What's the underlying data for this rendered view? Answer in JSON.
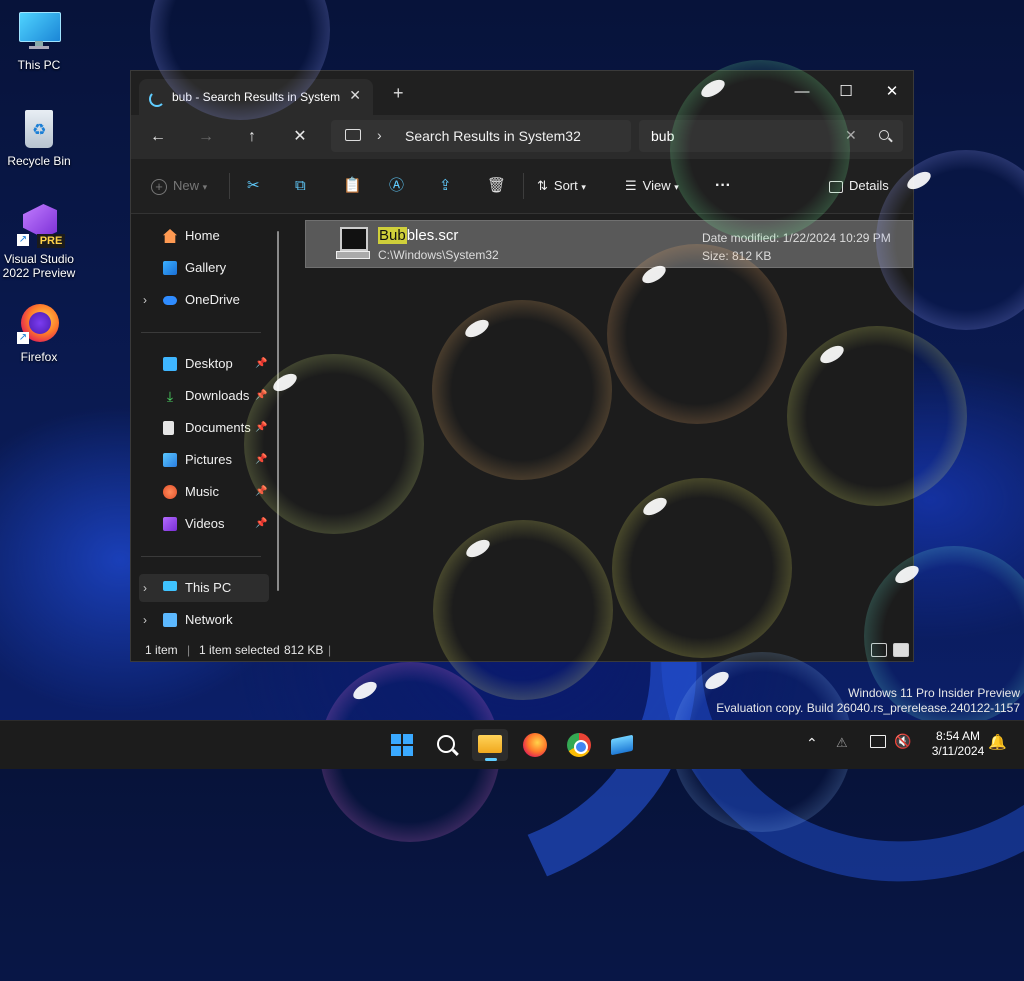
{
  "desktop": {
    "icons": [
      {
        "label": "This PC"
      },
      {
        "label": "Recycle Bin"
      },
      {
        "label_line1": "Visual Studio",
        "label_line2": "2022 Preview",
        "badge": "PRE"
      },
      {
        "label": "Firefox"
      }
    ]
  },
  "window": {
    "tab_title": "bub - Search Results in System",
    "tab_close": "✕",
    "new_tab": "+",
    "controls": {
      "minimize": "—",
      "maximize": "☐",
      "close": "✕"
    },
    "nav": {
      "back": "←",
      "forward": "→",
      "up": "↑",
      "stop": "✕"
    },
    "address": {
      "chevron": "›",
      "text": "Search Results in System32"
    },
    "search": {
      "value": "bub",
      "clear": "✕"
    },
    "toolbar": {
      "new_label": "New",
      "sort_label": "Sort",
      "view_label": "View",
      "more_label": "···",
      "details_label": "Details"
    },
    "sidebar": {
      "items": [
        {
          "label": "Home"
        },
        {
          "label": "Gallery"
        },
        {
          "label": "OneDrive"
        },
        {
          "label": "Desktop"
        },
        {
          "label": "Downloads"
        },
        {
          "label": "Documents"
        },
        {
          "label": "Pictures"
        },
        {
          "label": "Music"
        },
        {
          "label": "Videos"
        },
        {
          "label": "This PC"
        },
        {
          "label": "Network"
        }
      ]
    },
    "results": [
      {
        "name_match": "Bub",
        "name_rest": "bles.scr",
        "path": "C:\\Windows\\System32",
        "date_modified": "Date modified: 1/22/2024 10:29 PM",
        "size": "Size: 812 KB"
      }
    ],
    "status": {
      "item_count": "1 item",
      "selected": "1 item selected",
      "selected_size": "812 KB"
    }
  },
  "watermark": {
    "line1": "Windows 11 Pro Insider Preview",
    "line2": "Evaluation copy. Build 26040.rs_prerelease.240122-1157"
  },
  "taskbar": {
    "time": "8:54 AM",
    "date": "3/11/2024",
    "icons": [
      "start-icon",
      "search-icon",
      "file-explorer-icon",
      "firefox-icon",
      "chrome-icon",
      "sandbox-icon"
    ]
  },
  "colors": {
    "accent": "#60cdff",
    "selected_row": "#595959",
    "highlight": "#cfcf3a"
  }
}
